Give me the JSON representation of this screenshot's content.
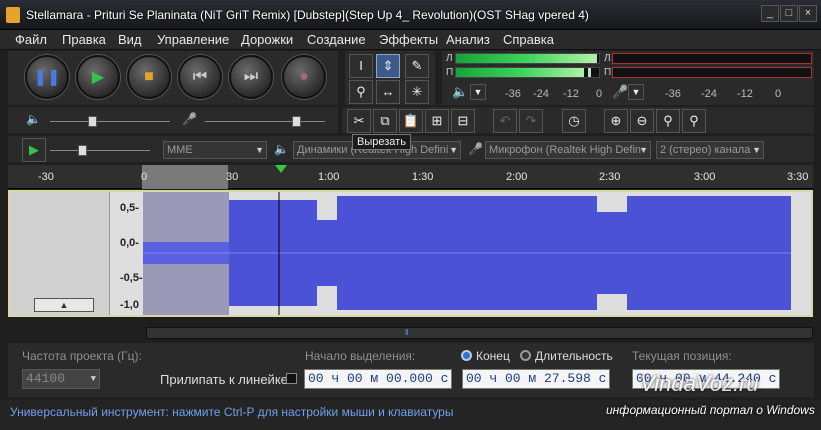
{
  "window": {
    "title": "Stellamara - Prituri Se Planinata (NiT GriT Remix) [Dubstep](Step Up 4_ Revolution)(OST SHag vpered 4)"
  },
  "menu": [
    "Файл",
    "Правка",
    "Вид",
    "Управление",
    "Дорожки",
    "Создание",
    "Эффекты",
    "Анализ",
    "Справка"
  ],
  "meters": {
    "left_label": "Л",
    "right_label": "П",
    "scale": [
      "-36",
      "-24",
      "-12",
      "0"
    ],
    "scale2": [
      "-36",
      "-24",
      "-12",
      "0"
    ]
  },
  "toolbar": {
    "tooltip": "Вырезать"
  },
  "devices": {
    "host": "MME",
    "playback": "Динамики (Realtek High Defini",
    "recording": "Микрофон (Realtek High Defin",
    "channels": "2 (стерео) канала"
  },
  "ruler": {
    "ticks": [
      "-30",
      "0",
      "30",
      "1:00",
      "1:30",
      "2:00",
      "2:30",
      "3:00",
      "3:30"
    ]
  },
  "track": {
    "amplitudes": [
      "0,5-",
      "0,0-",
      "-0,5-",
      "-1,0"
    ]
  },
  "bottom": {
    "project_rate_label": "Частота проекта (Гц):",
    "project_rate_value": "44100",
    "snap_label": "Прилипать к линейке",
    "sel_start_label": "Начало выделения:",
    "end_label": "Конец",
    "length_label": "Длительность",
    "position_label": "Текущая позиция:",
    "sel_start_value": "00 ч 00 м 00.000 с",
    "sel_end_value": "00 ч 00 м 27.598 с",
    "position_value": "00 ч 00 м 44.240 с"
  },
  "status": {
    "text": "Универсальный инструмент: нажмите Ctrl-P для настройки мыши и клавиатуры"
  },
  "watermark": {
    "line1": "VindaVoz.ru",
    "line2": "информационный портал о Windows"
  }
}
